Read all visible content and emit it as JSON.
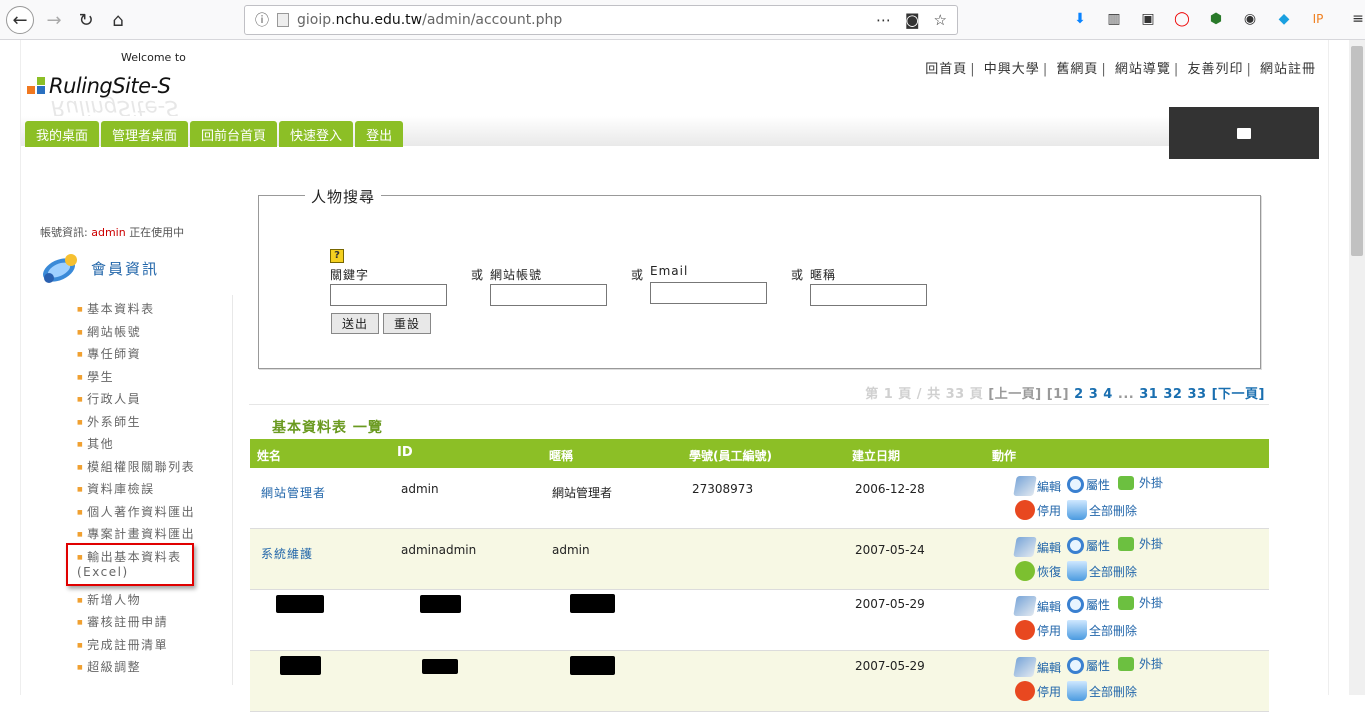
{
  "browser": {
    "url_prefix": "gioip.",
    "url_domain": "nchu.edu.tw",
    "url_path": "/admin/account.php",
    "more_icon": "⋯",
    "info_icon": "ⓘ"
  },
  "header": {
    "welcome": "Welcome to",
    "logo": "RulingSite-S",
    "top_links": [
      "回首頁",
      "中興大學",
      "舊網頁",
      "網站導覽",
      "友善列印",
      "網站註冊"
    ],
    "separator": "|"
  },
  "menu": [
    "我的桌面",
    "管理者桌面",
    "回前台首頁",
    "快速登入",
    "登出"
  ],
  "sidebar": {
    "account_prefix": "帳號資訊:",
    "account_user": "admin",
    "account_suffix": "正在使用中",
    "section_title": "會員資訊",
    "items": [
      "基本資料表",
      "網站帳號",
      "專任師資",
      "學生",
      "行政人員",
      "外系師生",
      "其他",
      "模組權限關聯列表",
      "資料庫檢誤",
      "個人著作資料匯出",
      "專案計畫資料匯出",
      "輸出基本資料表(Excel)",
      "新增人物",
      "審核註冊申請",
      "完成註冊清單",
      "超級調整"
    ]
  },
  "search": {
    "legend": "人物搜尋",
    "help_icon": "?",
    "fields": [
      "關鍵字",
      "網站帳號",
      "Email",
      "暱稱"
    ],
    "or": "或",
    "submit": "送出",
    "reset": "重設"
  },
  "pager": {
    "info": "第 1 頁 / 共 33 頁",
    "prev": "[上一頁]",
    "current": "[1]",
    "pages": "2 3 4",
    "ellipsis": "...",
    "tail": "31 32 33",
    "next": "[下一頁]"
  },
  "list": {
    "title": "基本資料表 一覽",
    "headers": [
      "姓名",
      "ID",
      "暱稱",
      "學號(員工編號)",
      "建立日期",
      "動作"
    ],
    "rows": [
      {
        "name": "網站管理者",
        "id": "admin",
        "nick": "網站管理者",
        "sid": "27308973",
        "date": "2006-12-28",
        "status": "停用"
      },
      {
        "name": "系統維護",
        "id": "adminadmin",
        "nick": "admin",
        "sid": "",
        "date": "2007-05-24",
        "status": "恢復"
      },
      {
        "name": "",
        "id": "",
        "nick": "",
        "sid": "",
        "date": "2007-05-29",
        "status": "停用"
      },
      {
        "name": "",
        "id": "",
        "nick": "",
        "sid": "",
        "date": "2007-05-29",
        "status": "停用"
      }
    ],
    "actions": {
      "edit": "編輯",
      "props": "屬性",
      "plugin": "外掛",
      "delete_all": "全部刪除"
    }
  }
}
